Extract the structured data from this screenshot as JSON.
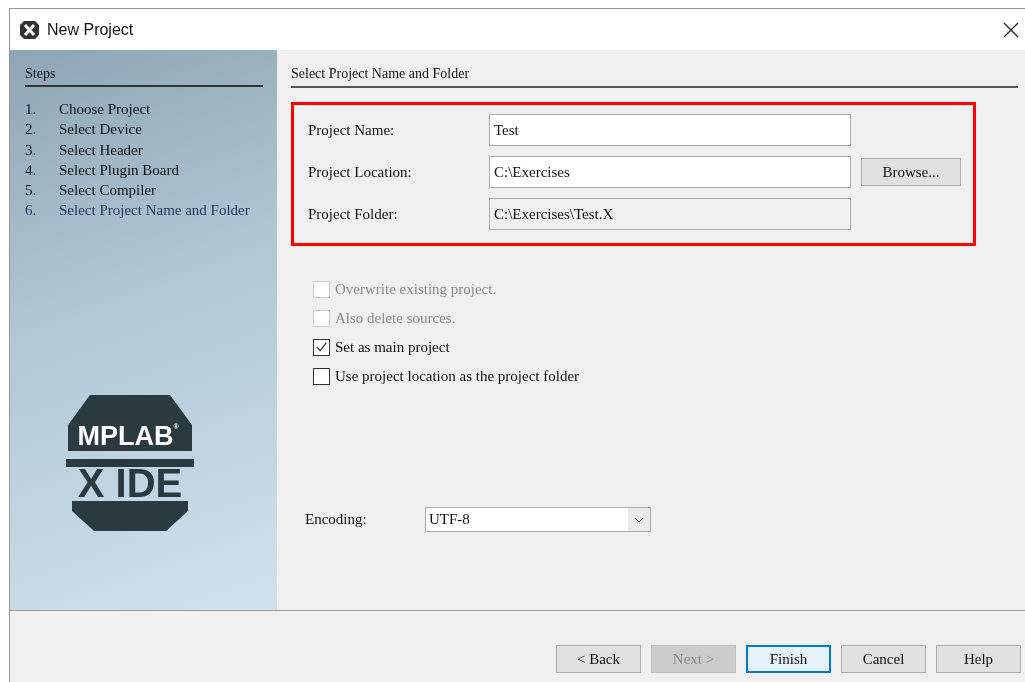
{
  "window": {
    "title": "New Project"
  },
  "steps": {
    "title": "Steps",
    "items": [
      {
        "number": "1.",
        "label": "Choose Project",
        "selected": false
      },
      {
        "number": "2.",
        "label": "Select Device",
        "selected": false
      },
      {
        "number": "3.",
        "label": "Select Header",
        "selected": false
      },
      {
        "number": "4.",
        "label": "Select Plugin Board",
        "selected": false
      },
      {
        "number": "5.",
        "label": "Select Compiler",
        "selected": false
      },
      {
        "number": "6.",
        "label": "Select Project Name and Folder",
        "selected": true
      }
    ]
  },
  "logo": {
    "line_1": "MPLAB",
    "mark": "®",
    "line_2": "X IDE"
  },
  "panel": {
    "title": "Select Project Name and Folder"
  },
  "fields": [
    {
      "label": "Project Name:",
      "value": "Test",
      "disabled": false
    },
    {
      "label": "Project Location:",
      "value": "C:\\Exercises",
      "disabled": false,
      "button": "Browse..."
    },
    {
      "label": "Project Folder:",
      "value": "C:\\Exercises\\Test.X",
      "disabled": true
    }
  ],
  "options": [
    {
      "label": "Overwrite existing project.",
      "checked": false,
      "disabled": true
    },
    {
      "label": "Also delete sources.",
      "checked": false,
      "disabled": true
    },
    {
      "label": "Set as main project",
      "checked": true,
      "disabled": false
    },
    {
      "label": "Use project location as the project folder",
      "checked": false,
      "disabled": false
    }
  ],
  "encoding": {
    "label": "Encoding:",
    "value": "UTF-8"
  },
  "buttons": [
    {
      "label": "< Back",
      "disabled": false,
      "default": false
    },
    {
      "label": "Next >",
      "disabled": true,
      "default": false
    },
    {
      "label": "Finish",
      "disabled": false,
      "default": true
    },
    {
      "label": "Cancel",
      "disabled": false,
      "default": false
    },
    {
      "label": "Help",
      "disabled": false,
      "default": false
    }
  ]
}
